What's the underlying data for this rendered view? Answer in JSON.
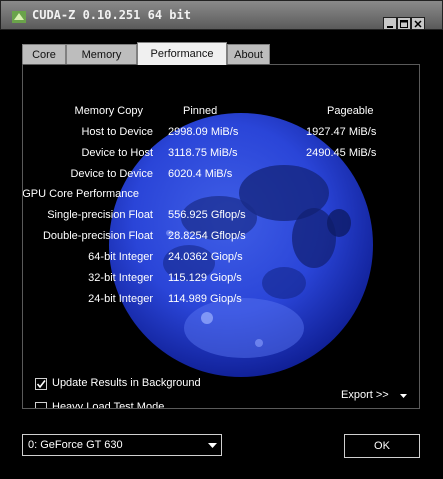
{
  "window": {
    "title": "CUDA-Z 0.10.251 64 bit"
  },
  "tabs": [
    {
      "label": "Core"
    },
    {
      "label": "Memory"
    },
    {
      "label": "Performance"
    },
    {
      "label": "About"
    }
  ],
  "performance": {
    "header": {
      "label": "Memory Copy",
      "pinned": "Pinned",
      "pageable": "Pageable"
    },
    "memory_rows": [
      {
        "label": "Host to Device",
        "pinned": "2998.09 MiB/s",
        "pageable": "1927.47 MiB/s"
      },
      {
        "label": "Device to Host",
        "pinned": "3118.75 MiB/s",
        "pageable": "2490.45 MiB/s"
      },
      {
        "label": "Device to Device",
        "pinned": "6020.4 MiB/s",
        "pageable": ""
      }
    ],
    "gpu_section": "GPU Core Performance",
    "gpu_rows": [
      {
        "label": "Single-precision Float",
        "value": "556.925 Gflop/s"
      },
      {
        "label": "Double-precision Float",
        "value": "28.8254 Gflop/s"
      },
      {
        "label": "64-bit Integer",
        "value": "24.0362 Giop/s"
      },
      {
        "label": "32-bit Integer",
        "value": "115.129 Giop/s"
      },
      {
        "label": "24-bit Integer",
        "value": "114.989 Giop/s"
      }
    ],
    "update_background": {
      "label": "Update Results in Background",
      "checked": true
    },
    "heavy_load": {
      "label": "Heavy Load Test Mode",
      "checked": false
    },
    "export_label": "Export >>"
  },
  "device_select": {
    "value": "0: GeForce GT 630"
  },
  "ok_label": "OK",
  "icons": {
    "app": "cuda-z-icon",
    "moon": "moon-image"
  }
}
